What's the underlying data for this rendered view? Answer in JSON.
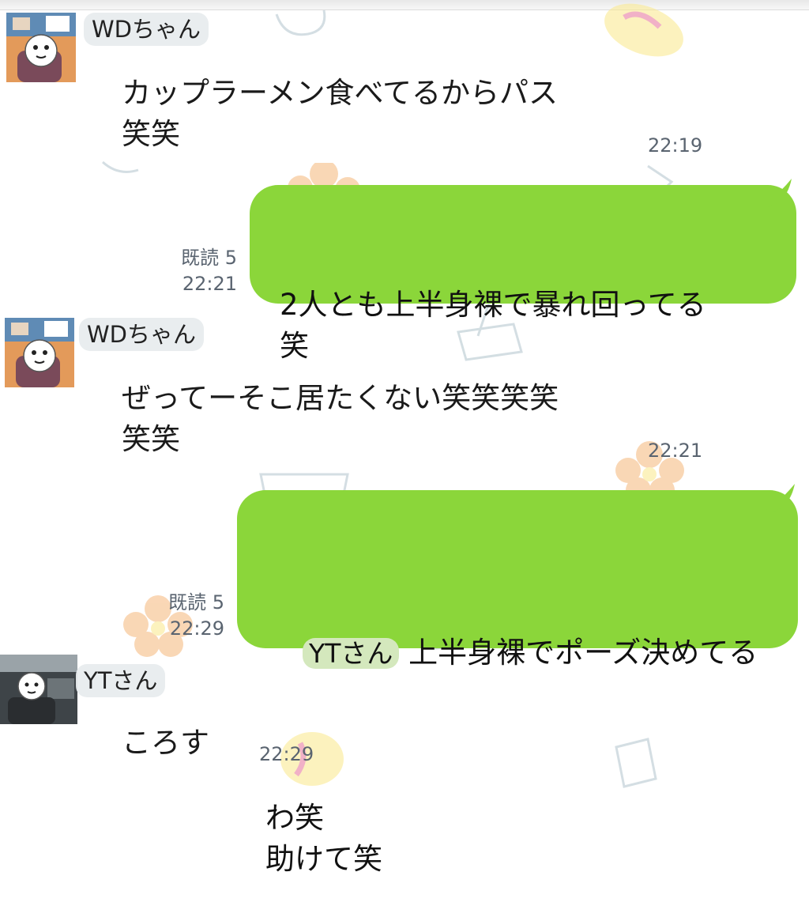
{
  "colors": {
    "outgoing_bubble": "#8bd63a",
    "incoming_bubble": "#ffffff",
    "meta_text": "#5a6470"
  },
  "messages": [
    {
      "sender": "WDちゃん",
      "text": "カップラーメン食べてるからパス\n笑笑",
      "time": "22:19"
    },
    {
      "read_label": "既読 5",
      "time": "22:21",
      "text": "2人とも上半身裸で暴れ回ってる\n笑"
    },
    {
      "sender": "WDちゃん",
      "text": "ぜってーそこ居たくない笑笑笑笑\n笑笑",
      "time": "22:21"
    },
    {
      "read_label": "既読 5",
      "time": "22:29",
      "mention": "YTさん",
      "text_after_mention": "上半身裸でポーズ決めてる",
      "text_rest": "わ笑\n助けて笑"
    },
    {
      "sender": "YTさん",
      "text": "ころす",
      "time": "22:29"
    }
  ]
}
